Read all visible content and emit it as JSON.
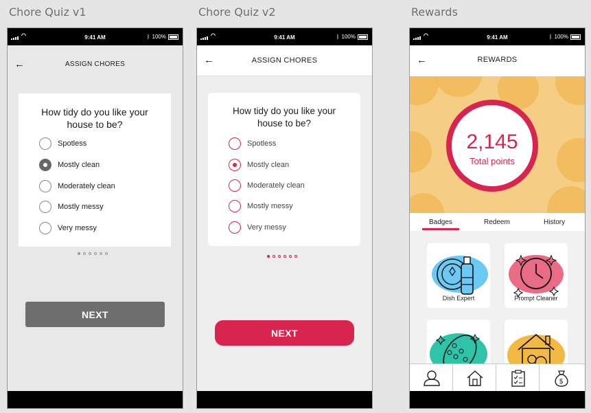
{
  "artboards": [
    "Chore Quiz v1",
    "Chore Quiz v2",
    "Rewards"
  ],
  "status": {
    "time": "9:41 AM",
    "battery": "100%"
  },
  "quiz": {
    "header_title": "ASSIGN CHORES",
    "question": "How tidy do you like your house to be?",
    "options": [
      "Spotless",
      "Mostly clean",
      "Moderately clean",
      "Mostly messy",
      "Very messy"
    ],
    "selected": "Mostly clean",
    "page_current": 1,
    "page_total": 6,
    "next_label": "NEXT"
  },
  "colors": {
    "accent": "#d8254f",
    "v1_button": "#6e6e6e",
    "hero_bg": "#f6cd84"
  },
  "rewards": {
    "header_title": "REWARDS",
    "points": "2,145",
    "points_label": "Total points",
    "tabs": [
      "Badges",
      "Redeem",
      "History"
    ],
    "active_tab": "Badges",
    "badges": [
      {
        "label": "Dish Expert",
        "icon": "plate-bottle-icon"
      },
      {
        "label": "Prompt Cleaner",
        "icon": "clock-icon"
      },
      {
        "label": "",
        "icon": "sponge-icon"
      },
      {
        "label": "",
        "icon": "house-bubbles-icon"
      }
    ],
    "nav": [
      "profile-icon",
      "home-icon",
      "clipboard-icon",
      "money-bag-icon"
    ]
  }
}
